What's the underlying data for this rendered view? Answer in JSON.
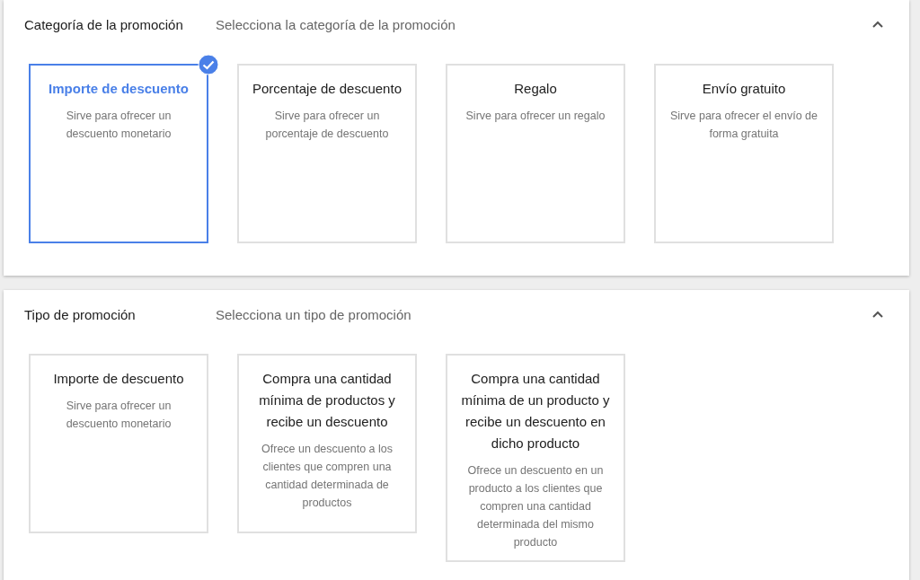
{
  "sections": [
    {
      "title": "Categoría de la promoción",
      "subtitle": "Selecciona la categoría de la promoción",
      "expanded": true,
      "options": [
        {
          "title": "Importe de descuento",
          "description": "Sirve para ofrecer un descuento monetario",
          "selected": true
        },
        {
          "title": "Porcentaje de descuento",
          "description": "Sirve para ofrecer un porcentaje de descuento",
          "selected": false
        },
        {
          "title": "Regalo",
          "description": "Sirve para ofrecer un regalo",
          "selected": false
        },
        {
          "title": "Envío gratuito",
          "description": "Sirve para ofrecer el envío de forma gratuita",
          "selected": false
        }
      ]
    },
    {
      "title": "Tipo de promoción",
      "subtitle": "Selecciona un tipo de promoción",
      "expanded": true,
      "options": [
        {
          "title": "Importe de descuento",
          "description": "Sirve para ofrecer un descuento monetario",
          "selected": false
        },
        {
          "title": "Compra una cantidad mínima de productos y recibe un descuento",
          "description": "Ofrece un descuento a los clientes que compren una cantidad determinada de productos",
          "selected": false
        },
        {
          "title": "Compra una cantidad mínima de un producto y recibe un descuento en dicho producto",
          "description": "Ofrece un descuento en un producto a los clientes que compren una cantidad determinada del mismo producto",
          "selected": false
        }
      ]
    }
  ]
}
